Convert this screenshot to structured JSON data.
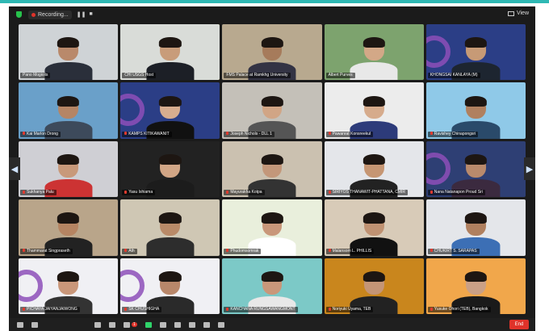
{
  "window": {
    "recording_label": "Recording...",
    "view_label": "View",
    "accent": "#2fb8b4"
  },
  "participants": [
    {
      "name": "Pano Mogiolis",
      "bg": "#cfd3d6",
      "skin": "#b9896b",
      "shirt": "#2a2f3a",
      "mic_off": false
    },
    {
      "name": "CHI USGS Host",
      "bg": "#d9dcd8",
      "skin": "#c89c7a",
      "shirt": "#1c1f26",
      "mic_off": false,
      "active": true
    },
    {
      "name": "FMS Palace at Ramkhg University",
      "bg": "#b8a98f",
      "skin": "#a67b5b",
      "shirt": "#334",
      "mic_off": false
    },
    {
      "name": "Albert Purves",
      "bg": "#7da36e",
      "skin": "#d3a887",
      "shirt": "#e8e8e8",
      "mic_off": false
    },
    {
      "name": "KHONGSAI KANLAYA (M)",
      "bg": "#2b3e86",
      "skin": "#c79a76",
      "shirt": "#1d2530",
      "mic_off": false
    },
    {
      "name": "Kai Marlon Drong",
      "bg": "#6aa0c9",
      "skin": "#b58565",
      "shirt": "#3d4a5b",
      "mic_off": true
    },
    {
      "name": "KAMPS KITIKAWANIT",
      "bg": "#2b3e86",
      "skin": "#d7ad8f",
      "shirt": "#111",
      "mic_off": true
    },
    {
      "name": "Joseph Nichols - DLL 1",
      "bg": "#c4c0b8",
      "skin": "#d1a585",
      "shirt": "#555",
      "mic_off": true
    },
    {
      "name": "Pawanrat Konsreekul",
      "bg": "#ececec",
      "skin": "#d6ab8c",
      "shirt": "#2d3b7a",
      "mic_off": true
    },
    {
      "name": "Ravishey Chinapongsri",
      "bg": "#8fc9e8",
      "skin": "#b0805f",
      "shirt": "#2a4a6a",
      "mic_off": true
    },
    {
      "name": "Sukhanya Palu",
      "bg": "#cfcfd4",
      "skin": "#c8997a",
      "shirt": "#c33",
      "mic_off": true
    },
    {
      "name": "Yasu Ishiama",
      "bg": "#222",
      "skin": "#d2a686",
      "shirt": "#1c1c1c",
      "mic_off": true
    },
    {
      "name": "Mayurakha Kotpa",
      "bg": "#cbc1b0",
      "skin": "#c3977a",
      "shirt": "#333",
      "mic_off": true
    },
    {
      "name": "SIRIYOS THANAWIT-PHATTANA, CMIR",
      "bg": "#e4e6ea",
      "skin": "#c69673",
      "shirt": "#222",
      "mic_off": true
    },
    {
      "name": "Nana Natanapon Proud Sri",
      "bg": "#2e3f74",
      "skin": "#b98a6c",
      "shirt": "#3b2a3f",
      "mic_off": true
    },
    {
      "name": "Thammarat Singpraseth",
      "bg": "#b9a58a",
      "skin": "#b58462",
      "shirt": "#222",
      "mic_off": true
    },
    {
      "name": "Ath",
      "bg": "#cfc7b4",
      "skin": "#b98a68",
      "shirt": "#2d2d2d",
      "mic_off": true
    },
    {
      "name": "Phudomsomrak",
      "bg": "#e9efdc",
      "skin": "#c9977a",
      "shirt": "#fff",
      "mic_off": true
    },
    {
      "name": "Malansom L. PHILLIS",
      "bg": "#d8cbb8",
      "skin": "#c09272",
      "shirt": "#111",
      "mic_off": true
    },
    {
      "name": "CHUKIRT S. SARAPAS",
      "bg": "#e4e6ea",
      "skin": "#b0805f",
      "shirt": "#3c6fb5",
      "mic_off": true
    },
    {
      "name": "PICHAYA JAIYANJAIWONG",
      "bg": "#f0f0f4",
      "skin": "#c9977a",
      "shirt": "#333",
      "mic_off": true
    },
    {
      "name": "SK CHUSHIGHA",
      "bg": "#f0f0f4",
      "skin": "#b8876a",
      "shirt": "#2a2a2a",
      "mic_off": true
    },
    {
      "name": "KANCHANA RUNGSAWANGMONT",
      "bg": "#7cc9c7",
      "skin": "#c9977a",
      "shirt": "#e8e8e8",
      "mic_off": true
    },
    {
      "name": "Noriyuki Uyama, TEB",
      "bg": "#c9861d",
      "skin": "#c49576",
      "shirt": "#222",
      "mic_off": true
    },
    {
      "name": "Yusuke Ohori (TEB), Bangkok",
      "bg": "#f1a74b",
      "skin": "#caa086",
      "shirt": "#1a1a1a",
      "mic_off": true
    }
  ],
  "toolbar": {
    "chat_badge": "1",
    "end_label": "End"
  }
}
